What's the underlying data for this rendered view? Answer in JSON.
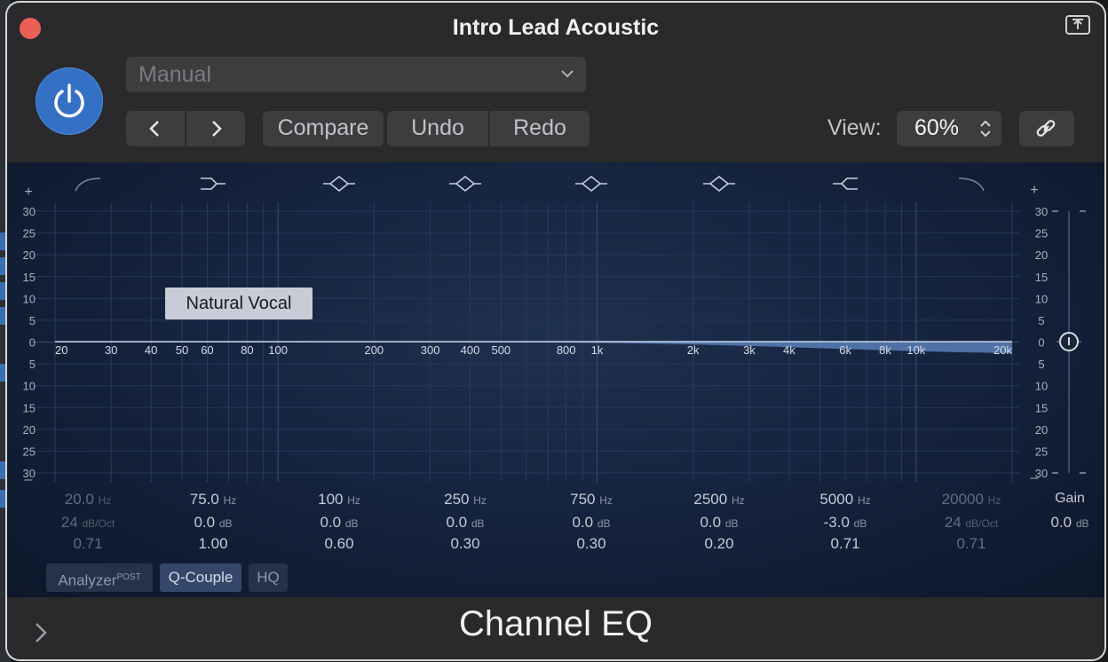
{
  "window": {
    "title": "Intro Lead Acoustic"
  },
  "toolbar": {
    "preset": "Manual",
    "compare": "Compare",
    "undo": "Undo",
    "redo": "Redo",
    "view_label": "View:",
    "view_value": "60%"
  },
  "eq": {
    "tooltip": "Natural Vocal",
    "db_ticks": [
      "30",
      "25",
      "20",
      "15",
      "10",
      "5",
      "0",
      "5",
      "10",
      "15",
      "20",
      "25",
      "30"
    ],
    "freq_labels": [
      "20",
      "30",
      "40",
      "50",
      "60",
      "80",
      "100",
      "200",
      "300",
      "400",
      "500",
      "800",
      "1k",
      "2k",
      "3k",
      "4k",
      "6k",
      "8k",
      "10k",
      "20k"
    ],
    "bands": [
      {
        "freq": "20.0",
        "freq_unit": "Hz",
        "gain": "24",
        "gain_unit": "dB/Oct",
        "q": "0.71",
        "enabled": false,
        "type_icon": "low-cut-icon"
      },
      {
        "freq": "75.0",
        "freq_unit": "Hz",
        "gain": "0.0",
        "gain_unit": "dB",
        "q": "1.00",
        "enabled": true,
        "type_icon": "low-shelf-icon"
      },
      {
        "freq": "100",
        "freq_unit": "Hz",
        "gain": "0.0",
        "gain_unit": "dB",
        "q": "0.60",
        "enabled": true,
        "type_icon": "bell-icon"
      },
      {
        "freq": "250",
        "freq_unit": "Hz",
        "gain": "0.0",
        "gain_unit": "dB",
        "q": "0.30",
        "enabled": true,
        "type_icon": "bell-icon"
      },
      {
        "freq": "750",
        "freq_unit": "Hz",
        "gain": "0.0",
        "gain_unit": "dB",
        "q": "0.30",
        "enabled": true,
        "type_icon": "bell-icon"
      },
      {
        "freq": "2500",
        "freq_unit": "Hz",
        "gain": "0.0",
        "gain_unit": "dB",
        "q": "0.20",
        "enabled": true,
        "type_icon": "bell-icon"
      },
      {
        "freq": "5000",
        "freq_unit": "Hz",
        "gain": "-3.0",
        "gain_unit": "dB",
        "q": "0.71",
        "enabled": true,
        "type_icon": "high-shelf-icon"
      },
      {
        "freq": "20000",
        "freq_unit": "Hz",
        "gain": "24",
        "gain_unit": "dB/Oct",
        "q": "0.71",
        "enabled": false,
        "type_icon": "high-cut-icon"
      }
    ],
    "gain_label": "Gain",
    "gain_value": "0.0",
    "gain_unit": "dB",
    "analyzer": "Analyzer",
    "analyzer_mode": "POST",
    "qcouple": "Q-Couple",
    "hq": "HQ"
  },
  "footer": {
    "plugin_name": "Channel EQ"
  },
  "colors": {
    "accent": "#3471c4",
    "close": "#ec5f57",
    "curve_fill": "#5b7fb8"
  }
}
